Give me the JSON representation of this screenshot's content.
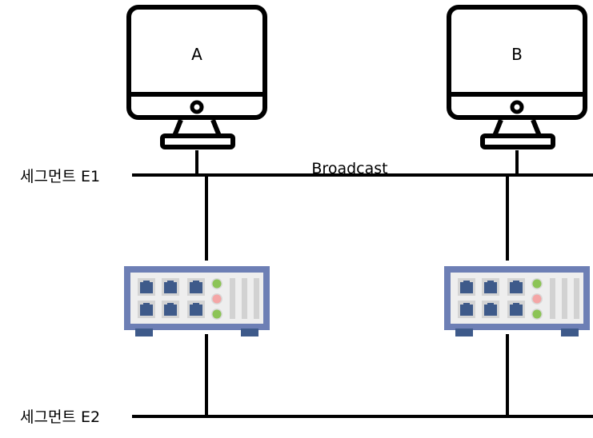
{
  "hosts": [
    {
      "label": "A"
    },
    {
      "label": "B"
    }
  ],
  "segments": {
    "e1": "세그먼트 E1",
    "e2": "세그먼트 E2"
  },
  "broadcast_label": "Broadcast",
  "colors": {
    "switch_frame": "#6d7fb5",
    "switch_panel": "#eeeeee",
    "port": "#3e5a8a",
    "led_green": "#8cc456",
    "led_red": "#f4a6a6",
    "slot": "#d2d2d2"
  }
}
